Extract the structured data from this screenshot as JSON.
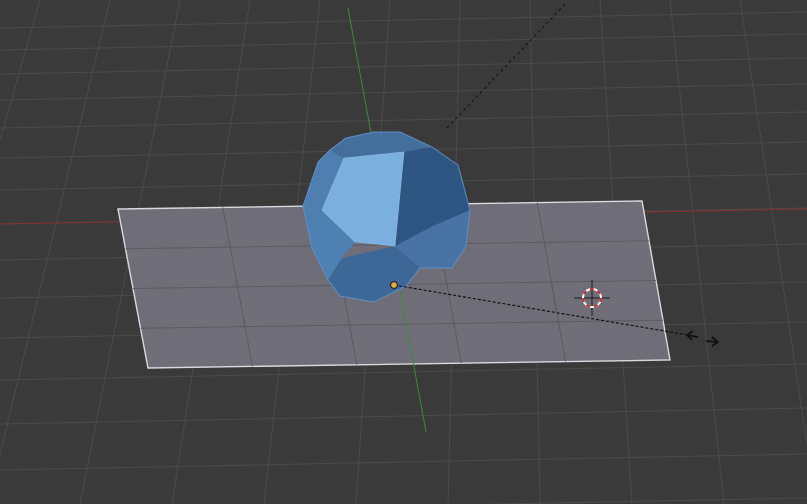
{
  "viewport": {
    "background": "#3a3a3a",
    "grid_color": "#4a4a4a",
    "x_axis_color": "#8a2f2f",
    "y_axis_color": "#3c8c3c"
  },
  "plane": {
    "fill": "#6f6e78",
    "edge": "#d9d9e0",
    "inner_grid": "#5a5a62"
  },
  "mesh": {
    "type": "truncated-octahedron",
    "face_colors": [
      "#7bb0de",
      "#4f80b2",
      "#3c6796",
      "#5b8cc0",
      "#446f9c",
      "#2f5582"
    ]
  },
  "cursor_3d": {
    "outer": "#dfe0e6",
    "ring_red": "#cc2a2a",
    "ring_white": "#ffffff"
  },
  "transform": {
    "pivot_color": "#e7a93a",
    "line_color": "#111111",
    "arrow_icon": "move-arrows-icon"
  }
}
